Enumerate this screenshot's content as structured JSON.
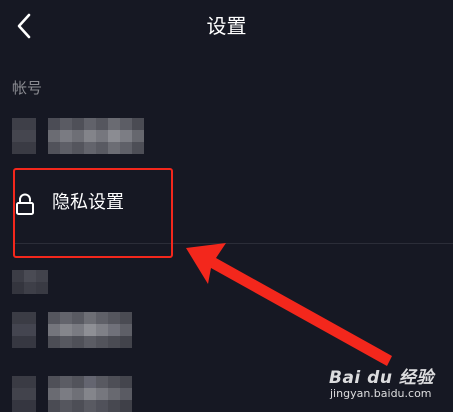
{
  "header": {
    "title": "设置",
    "back_icon": "chevron-left-icon"
  },
  "section": {
    "account_label": "帐号"
  },
  "menu": {
    "privacy_label": "隐私设置",
    "privacy_icon": "lock-icon"
  },
  "annotation": {
    "color": "#f3271c"
  },
  "watermark": {
    "brand": "Bai du 经验",
    "domain": "jingyan.baidu.com"
  },
  "colors": {
    "background": "#161823",
    "secondary_text": "#8a8b91",
    "divider": "#2b2d38"
  }
}
